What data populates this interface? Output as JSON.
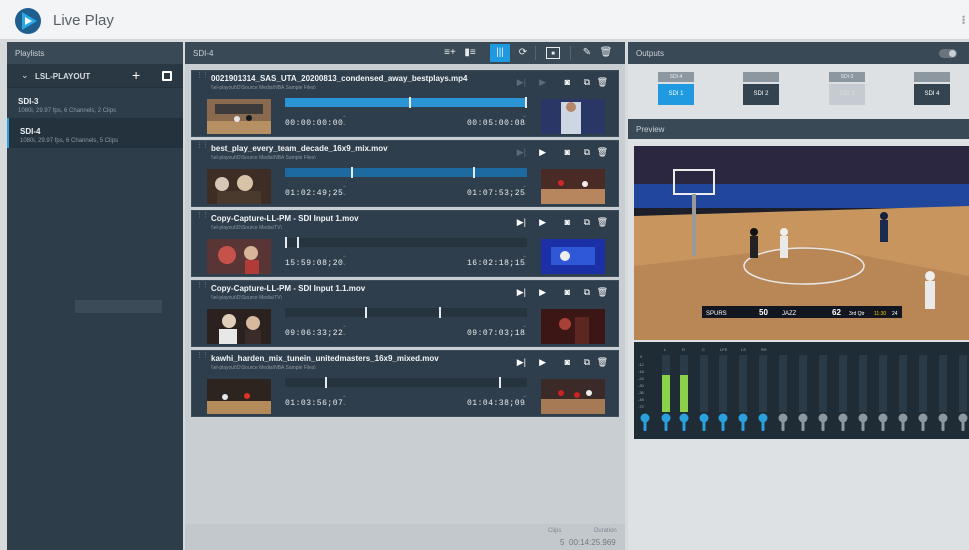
{
  "app": {
    "title": "Live Play"
  },
  "left": {
    "header": "Playlists",
    "playlist_name": "LSL-PLAYOUT",
    "devices": [
      {
        "name": "SDI-3",
        "desc": "1080i, 29.97 fps, 6 Channels, 2 Clips"
      },
      {
        "name": "SDI-4",
        "desc": "1080i, 29.97 fps, 6 Channels, 5 Clips"
      }
    ]
  },
  "center": {
    "title": "SDI-4",
    "clips": [
      {
        "name": "0021901314_SAS_UTA_20200813_condensed_away_bestplays.mp4",
        "path": "\\\\el-playout\\D\\Source Media\\NBA Sample Files\\",
        "in": "00:00:00:00",
        "out": "00:05:00:08",
        "progress": 1.0
      },
      {
        "name": "best_play_every_team_decade_16x9_mix.mov",
        "path": "\\\\el-playout\\D\\Source Media\\NBA Sample Files\\",
        "in": "01:02:49;25",
        "out": "01:07:53;25",
        "progress": 0.0
      },
      {
        "name": "Copy-Capture-LL-PM - SDI Input 1.mov",
        "path": "\\\\el-playout\\D\\Source Media\\TV\\",
        "in": "15:59:08;20",
        "out": "16:02:18;15",
        "progress": 0.0
      },
      {
        "name": "Copy-Capture-LL-PM - SDI Input 1.1.mov",
        "path": "\\\\el-playout\\D\\Source Media\\TV\\",
        "in": "09:06:33;22",
        "out": "09:07:03;18",
        "progress": 0.0
      },
      {
        "name": "kawhi_harden_mix_tunein_unitedmasters_16x9_mixed.mov",
        "path": "\\\\el-playout\\D\\Source Media\\NBA Sample Files\\",
        "in": "01:03:56;07",
        "out": "01:04:38;09",
        "progress": 0.0
      }
    ],
    "footer": {
      "clips_label": "Clips",
      "duration_label": "Duration",
      "clips_value": "5",
      "duration_value": "00:14:25.969"
    }
  },
  "right": {
    "outputs_label": "Outputs",
    "preview_label": "Preview",
    "outputs": [
      {
        "top": "SDI-4",
        "label": "SDI 1",
        "state": "active"
      },
      {
        "top": "",
        "label": "SDI 2",
        "state": "normal"
      },
      {
        "top": "SDI-3",
        "label": "SDI 3",
        "state": "disabled"
      },
      {
        "top": "",
        "label": "SDI 4",
        "state": "normal"
      }
    ],
    "scoreboard": {
      "team1": "SPURS",
      "score1": "50",
      "team2": "JAZZ",
      "score2": "62",
      "period": "3rd Qtr",
      "clock": "11:30",
      "shot": "24"
    },
    "meter_labels": [
      "L",
      "R",
      "C",
      "LFE",
      "LS",
      "RS"
    ],
    "meter_scale": [
      "0",
      "-12",
      "-18",
      "-24",
      "-30",
      "-36",
      "-48",
      "-72"
    ]
  }
}
